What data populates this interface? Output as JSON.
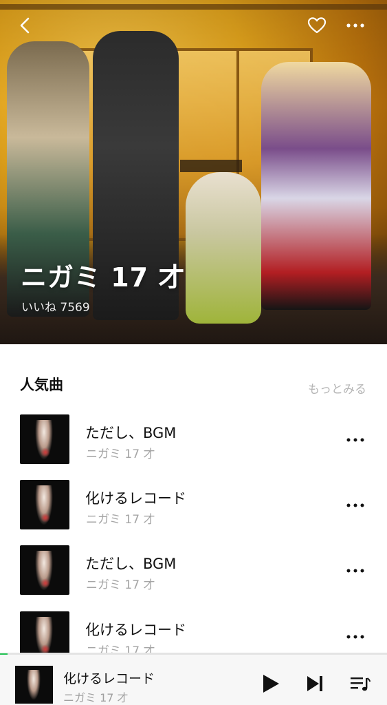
{
  "artist": {
    "name": "ニガミ 17 才",
    "likes_text": "いいね 7569"
  },
  "popular": {
    "section_title": "人気曲",
    "see_more_label": "もっとみる",
    "songs": [
      {
        "title": "ただし、BGM",
        "artist": "ニガミ 17 才"
      },
      {
        "title": "化けるレコード",
        "artist": "ニガミ 17 才"
      },
      {
        "title": "ただし、BGM",
        "artist": "ニガミ 17 才"
      },
      {
        "title": "化けるレコード",
        "artist": "ニガミ 17 才"
      }
    ]
  },
  "player": {
    "title": "化けるレコード",
    "artist": "ニガミ 17 才",
    "progress": 0.02
  },
  "colors": {
    "accent": "#23c454",
    "text_primary": "#111111",
    "text_secondary": "#a5a5a5"
  },
  "icons": {
    "back": "back-chevron-icon",
    "like": "heart-icon",
    "more": "more-horizontal-icon",
    "play": "play-icon",
    "next": "skip-next-icon",
    "queue": "queue-list-icon"
  }
}
